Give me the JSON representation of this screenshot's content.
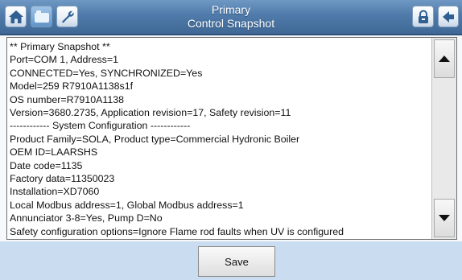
{
  "header": {
    "title_line1": "Primary",
    "title_line2": "Control Snapshot",
    "left_icons": [
      "home-icon",
      "screen-icon",
      "wrench-icon"
    ],
    "right_icons": [
      "lock-icon",
      "back-icon"
    ]
  },
  "snapshot": {
    "lines": [
      "** Primary Snapshot **",
      "Port=COM 1, Address=1",
      "CONNECTED=Yes, SYNCHRONIZED=Yes",
      "Model=259 R7910A1138s1f",
      "OS number=R7910A1138",
      "Version=3680.2735, Application revision=17, Safety revision=11",
      "------------ System Configuration ------------",
      "Product Family=SOLA, Product type=Commercial Hydronic Boiler",
      "OEM ID=LAARSHS",
      "Date code=1135",
      "Factory data=11350023",
      "Installation=XD7060",
      "Local Modbus address=1, Global Modbus address=1",
      "Annunciator 3-8=Yes, Pump D=No",
      "Safety configuration options=Ignore Flame rod faults when UV is configured"
    ]
  },
  "footer": {
    "save_label": "Save"
  },
  "colors": {
    "header_blue": "#4f7aa9",
    "footer_blue": "#c9dcf0"
  }
}
